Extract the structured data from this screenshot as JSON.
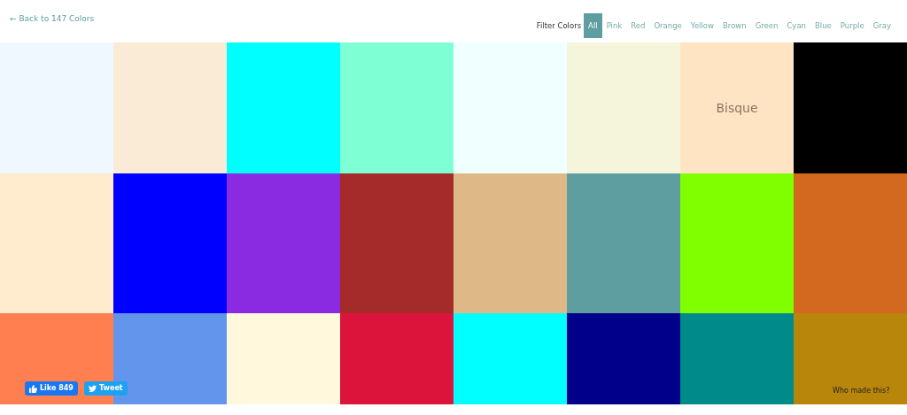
{
  "back_link": {
    "arrow": "←",
    "label": "Back to 147 Colors"
  },
  "filter": {
    "label": "Filter Colors",
    "options": [
      {
        "label": "All",
        "selected": true
      },
      {
        "label": "Pink",
        "selected": false
      },
      {
        "label": "Red",
        "selected": false
      },
      {
        "label": "Orange",
        "selected": false
      },
      {
        "label": "Yellow",
        "selected": false
      },
      {
        "label": "Brown",
        "selected": false
      },
      {
        "label": "Green",
        "selected": false
      },
      {
        "label": "Cyan",
        "selected": false
      },
      {
        "label": "Blue",
        "selected": false
      },
      {
        "label": "Purple",
        "selected": false
      },
      {
        "label": "Gray",
        "selected": false
      }
    ]
  },
  "swatches": [
    {
      "color": "#f0f8ff"
    },
    {
      "color": "#faebd7"
    },
    {
      "color": "#00ffff"
    },
    {
      "color": "#7fffd4"
    },
    {
      "color": "#f0ffff"
    },
    {
      "color": "#f5f5dc"
    },
    {
      "color": "#ffe4c4",
      "label": "Bisque"
    },
    {
      "color": "#000000"
    },
    {
      "color": "#ffebcd"
    },
    {
      "color": "#0000ff"
    },
    {
      "color": "#8a2be2"
    },
    {
      "color": "#a52a2a"
    },
    {
      "color": "#deb887"
    },
    {
      "color": "#5f9ea0"
    },
    {
      "color": "#7fff00"
    },
    {
      "color": "#d2691e"
    },
    {
      "color": "#ff7f50"
    },
    {
      "color": "#6495ed"
    },
    {
      "color": "#fff8dc"
    },
    {
      "color": "#dc143c"
    },
    {
      "color": "#00ffff"
    },
    {
      "color": "#00008b"
    },
    {
      "color": "#008b8b"
    },
    {
      "color": "#b8860b"
    }
  ],
  "like_button": {
    "label": "Like 849"
  },
  "tweet_button": {
    "label": "Tweet"
  },
  "credit_link": "Who made this?"
}
